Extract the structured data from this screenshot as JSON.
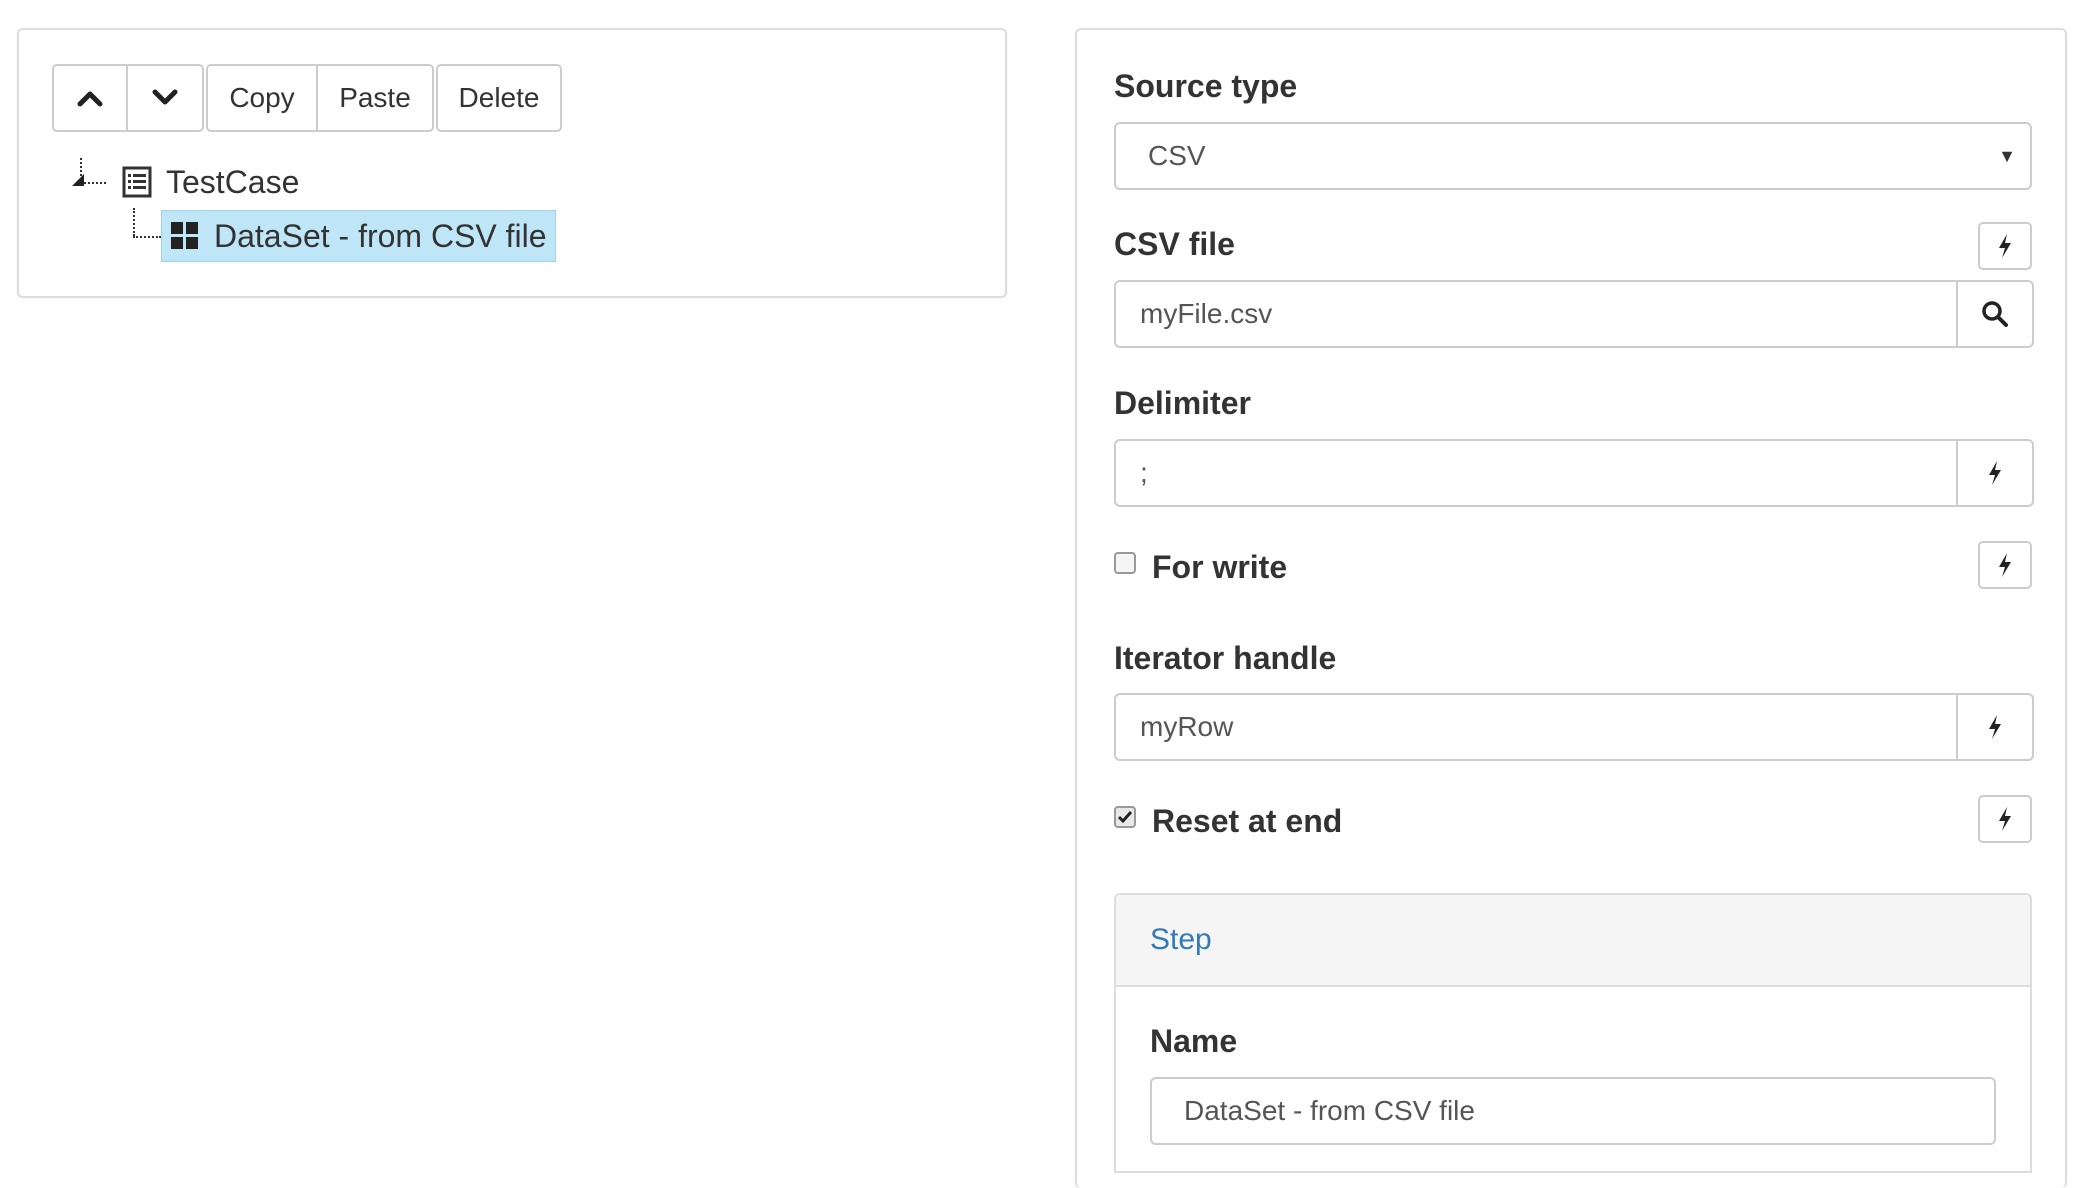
{
  "toolbar": {
    "move_up_icon": "chevron-up-icon",
    "move_down_icon": "chevron-down-icon",
    "copy_label": "Copy",
    "paste_label": "Paste",
    "delete_label": "Delete"
  },
  "tree": {
    "root_label": "TestCase",
    "root_icon": "list-icon",
    "child_label": "DataSet - from CSV file",
    "child_icon": "grid-icon",
    "selected_color": "#bfe6f7"
  },
  "form": {
    "source_type_label": "Source type",
    "source_type_value": "CSV",
    "csv_file_label": "CSV file",
    "csv_file_value": "myFile.csv",
    "delimiter_label": "Delimiter",
    "delimiter_value": ";",
    "for_write_label": "For write",
    "for_write_checked": false,
    "iterator_handle_label": "Iterator handle",
    "iterator_handle_value": "myRow",
    "reset_at_end_label": "Reset at end",
    "reset_at_end_checked": true
  },
  "step": {
    "header": "Step",
    "name_label": "Name",
    "name_value": "DataSet - from CSV file",
    "header_color": "#337ab7"
  }
}
